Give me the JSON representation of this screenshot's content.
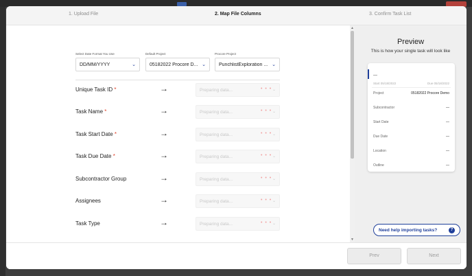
{
  "steps": {
    "upload": "1. Upload File",
    "map": "2. Map File Columns",
    "confirm": "3. Confirm Task List"
  },
  "selectors": {
    "date_format": {
      "label": "Select Date Format You Use",
      "value": "DD/MM/YYYY"
    },
    "default_project": {
      "label": "Default Project",
      "value": "05182022 Procore D..."
    },
    "procore_project": {
      "label": "Procore Project",
      "value": "PunchlistExploration ..."
    }
  },
  "mapping": {
    "placeholder": "Preparing data...",
    "loading_dots": "• • •",
    "rows": [
      {
        "label": "Unique Task ID",
        "required": "*"
      },
      {
        "label": "Task Name",
        "required": "*"
      },
      {
        "label": "Task Start Date",
        "required": "*"
      },
      {
        "label": "Task Due Date",
        "required": "*"
      },
      {
        "label": "Subcontractor Group",
        "required": ""
      },
      {
        "label": "Assignees",
        "required": ""
      },
      {
        "label": "Task Type",
        "required": ""
      }
    ]
  },
  "preview": {
    "title": "Preview",
    "subtitle": "This is how your single task will look like",
    "task_name": "—",
    "start": "Start 05/18/2022",
    "due": "Due 05/18/2022",
    "fields": [
      {
        "label": "Project",
        "value": "05182022 Procore Demo"
      },
      {
        "label": "Subcontractor",
        "value": "—"
      },
      {
        "label": "Start Date",
        "value": "—"
      },
      {
        "label": "Due Date",
        "value": "—"
      },
      {
        "label": "Location",
        "value": "—"
      },
      {
        "label": "Outline",
        "value": "—"
      }
    ],
    "help": "Need help importing tasks?"
  },
  "footer": {
    "prev": "Prev",
    "next": "Next"
  },
  "icons": {
    "arrow": "arrow-right-icon",
    "chevron": "chevron-down-icon",
    "help": "question-icon"
  },
  "colors": {
    "accent": "#1f3f9a",
    "required": "#e0432b",
    "loading": "#f2a3a3"
  }
}
